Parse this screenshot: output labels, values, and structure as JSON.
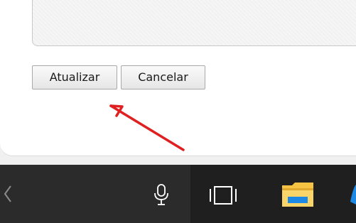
{
  "form": {
    "update_label": "Atualizar",
    "cancel_label": "Cancelar"
  },
  "colors": {
    "arrow": "#e02020",
    "taskbar": "#1f1f1f",
    "folder_yellow": "#f6c343",
    "folder_blue": "#1e88e5"
  },
  "taskbar": {
    "icons": [
      "chevron-left-icon",
      "microphone-icon",
      "task-view-icon",
      "file-explorer-icon",
      "edge-icon"
    ]
  }
}
